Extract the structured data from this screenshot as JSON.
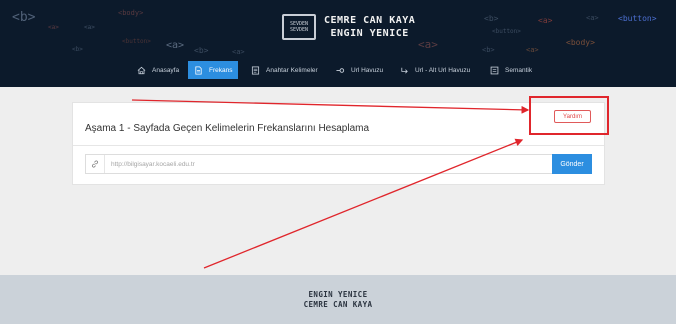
{
  "header": {
    "brand": {
      "logo_text": "SEVDEN\nSEVDEN",
      "name_line_1": "CEMRE CAN KAYA",
      "name_line_2": "ENGIN YENICE"
    },
    "decorations": [
      "<b>",
      "<body>",
      "<a>",
      "<button>",
      "<a>",
      "<b>",
      "<a>",
      "<b>",
      "<a>",
      "<a>",
      "<button>",
      "<body>",
      "<a>",
      "<a>",
      "<b>",
      "<b>",
      "<a>",
      "<button>"
    ]
  },
  "nav": {
    "items": [
      {
        "label": "Anasayfa",
        "icon": "home-icon",
        "active": false
      },
      {
        "label": "Frekans",
        "icon": "document-icon",
        "active": true
      },
      {
        "label": "Anahtar Kelimeler",
        "icon": "list-icon",
        "active": false
      },
      {
        "label": "Url Havuzu",
        "icon": "link-icon",
        "active": false
      },
      {
        "label": "Url - Alt Url Havuzu",
        "icon": "share-icon",
        "active": false
      },
      {
        "label": "Semantik",
        "icon": "grid-icon",
        "active": false
      }
    ]
  },
  "main": {
    "card_title": "Aşama 1 - Sayfada Geçen Kelimelerin Frekanslarını Hesaplama",
    "help_label": "Yardım",
    "url_placeholder": "http://bilgisayar.kocaeli.edu.tr",
    "send_label": "Gönder"
  },
  "footer": {
    "line_1": "ENGIN YENICE",
    "line_2": "CEMRE CAN KAYA"
  },
  "colors": {
    "header_bg": "#0c1a2b",
    "accent": "#2c8ee0",
    "page_bg": "#eeeeee",
    "footer_bg": "#cbd2d9",
    "annotation": "#e0262c"
  }
}
